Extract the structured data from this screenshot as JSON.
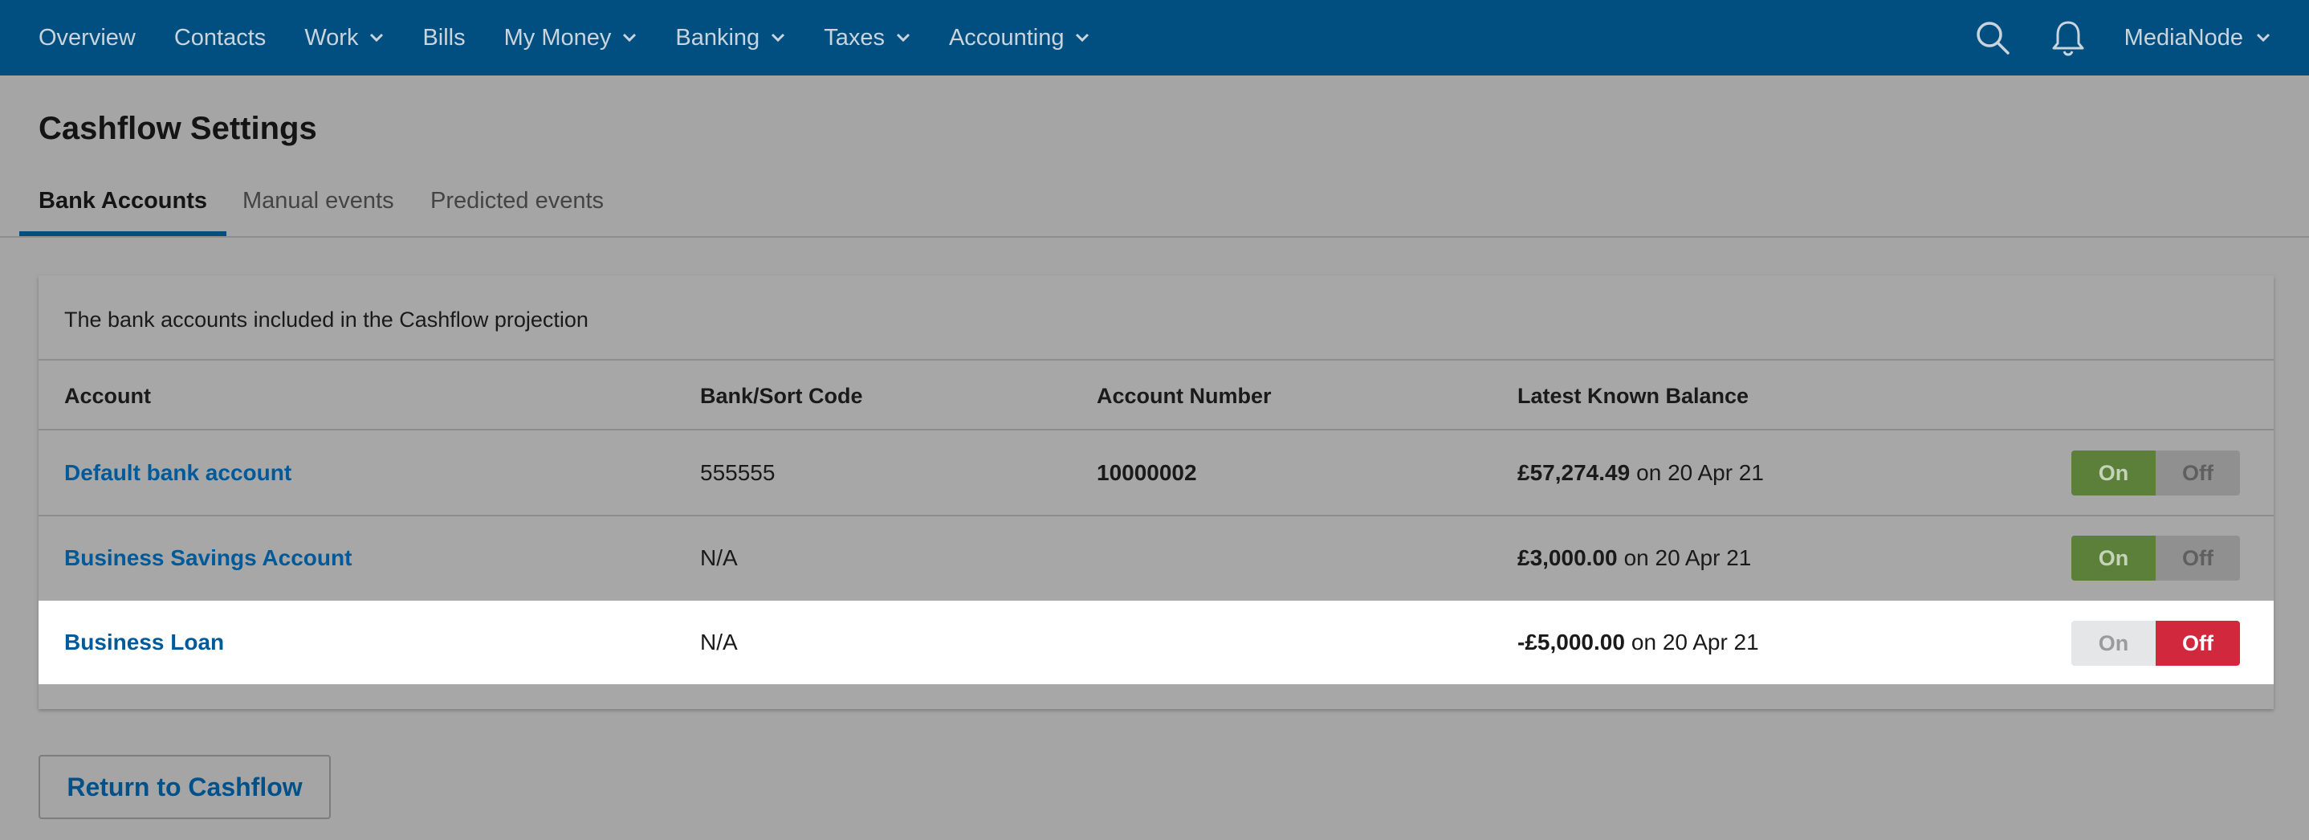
{
  "nav": {
    "items": [
      {
        "label": "Overview",
        "has_menu": false
      },
      {
        "label": "Contacts",
        "has_menu": false
      },
      {
        "label": "Work",
        "has_menu": true
      },
      {
        "label": "Bills",
        "has_menu": false
      },
      {
        "label": "My Money",
        "has_menu": true
      },
      {
        "label": "Banking",
        "has_menu": true
      },
      {
        "label": "Taxes",
        "has_menu": true
      },
      {
        "label": "Accounting",
        "has_menu": true
      }
    ],
    "search_icon": "search-icon",
    "notification_icon": "bell-icon",
    "account_label": "MediaNode"
  },
  "page": {
    "title": "Cashflow Settings"
  },
  "tabs": [
    {
      "label": "Bank Accounts",
      "active": true
    },
    {
      "label": "Manual events",
      "active": false
    },
    {
      "label": "Predicted events",
      "active": false
    }
  ],
  "panel": {
    "intro": "The bank accounts included in the Cashflow projection",
    "columns": {
      "account": "Account",
      "sort_code": "Bank/Sort Code",
      "account_number": "Account Number",
      "balance": "Latest Known Balance"
    },
    "rows": [
      {
        "account": "Default bank account",
        "sort_code": "555555",
        "account_number": "10000002",
        "balance": "£57,274.49",
        "balance_date": "on 20 Apr 21",
        "included": true
      },
      {
        "account": "Business Savings Account",
        "sort_code": "N/A",
        "account_number": "",
        "balance": "£3,000.00",
        "balance_date": "on 20 Apr 21",
        "included": true
      },
      {
        "account": "Business Loan",
        "sort_code": "N/A",
        "account_number": "",
        "balance": "-£5,000.00",
        "balance_date": "on 20 Apr 21",
        "included": false
      }
    ],
    "toggle_on": "On",
    "toggle_off": "Off"
  },
  "return_button": "Return to Cashflow",
  "colors": {
    "nav_bg": "#004f80",
    "link": "#005a99",
    "on_active": "#5c7f3a",
    "off_active": "#d2283d"
  }
}
